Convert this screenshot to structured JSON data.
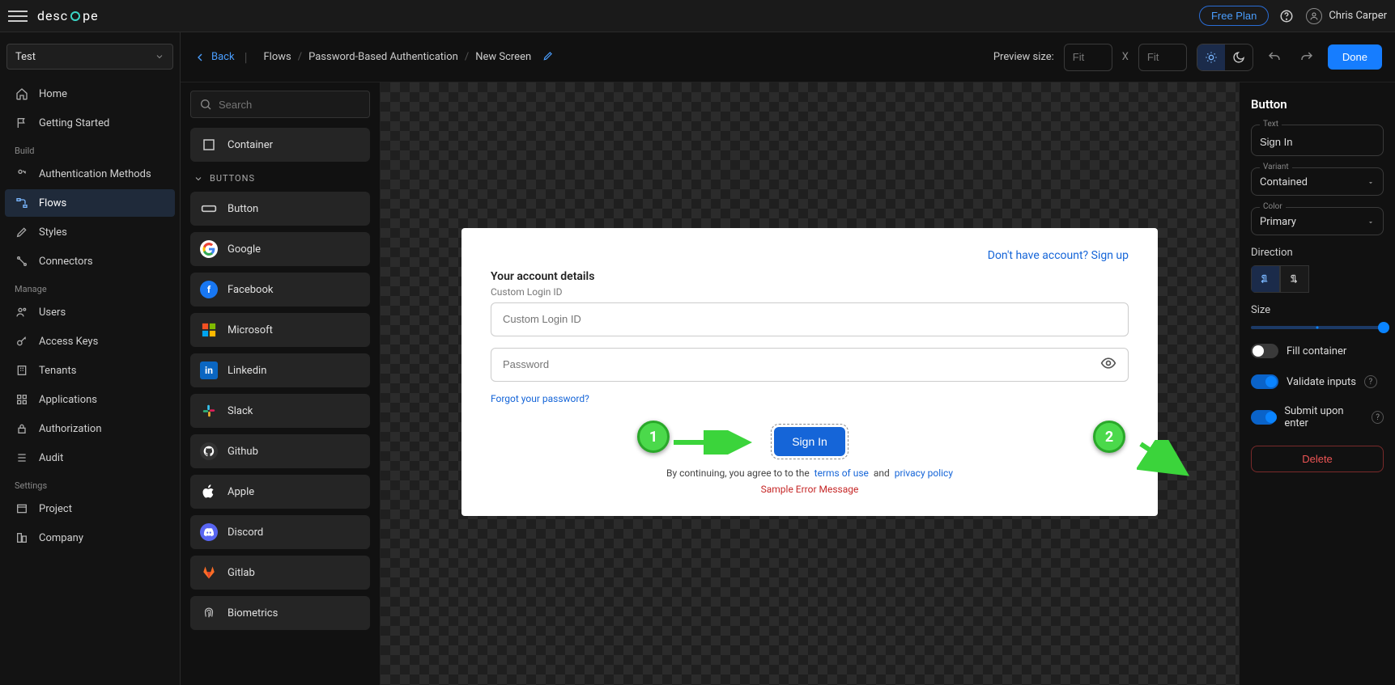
{
  "topbar": {
    "brand": "descope",
    "free_plan": "Free Plan",
    "user_name": "Chris Carper"
  },
  "sidebar": {
    "env": "Test",
    "groups": [
      {
        "items": [
          {
            "label": "Home",
            "icon": "home"
          },
          {
            "label": "Getting Started",
            "icon": "flag"
          }
        ]
      },
      {
        "label": "Build",
        "items": [
          {
            "label": "Authentication Methods",
            "icon": "auth"
          },
          {
            "label": "Flows",
            "icon": "flows",
            "active": true
          },
          {
            "label": "Styles",
            "icon": "styles"
          },
          {
            "label": "Connectors",
            "icon": "connectors"
          }
        ]
      },
      {
        "label": "Manage",
        "items": [
          {
            "label": "Users",
            "icon": "users"
          },
          {
            "label": "Access Keys",
            "icon": "keys"
          },
          {
            "label": "Tenants",
            "icon": "tenants"
          },
          {
            "label": "Applications",
            "icon": "apps"
          },
          {
            "label": "Authorization",
            "icon": "authz"
          },
          {
            "label": "Audit",
            "icon": "audit"
          }
        ]
      },
      {
        "label": "Settings",
        "items": [
          {
            "label": "Project",
            "icon": "project"
          },
          {
            "label": "Company",
            "icon": "company"
          }
        ]
      }
    ]
  },
  "toolbar": {
    "back": "Back",
    "crumbs": [
      "Flows",
      "Password-Based Authentication",
      "New Screen"
    ],
    "preview_label": "Preview size:",
    "fit_w": "Fit",
    "fit_h": "Fit",
    "done": "Done"
  },
  "palette": {
    "search_placeholder": "Search",
    "container": "Container",
    "buttons_label": "BUTTONS",
    "items": [
      {
        "label": "Button",
        "icon": "button"
      },
      {
        "label": "Google",
        "icon": "google"
      },
      {
        "label": "Facebook",
        "icon": "facebook"
      },
      {
        "label": "Microsoft",
        "icon": "microsoft"
      },
      {
        "label": "Linkedin",
        "icon": "linkedin"
      },
      {
        "label": "Slack",
        "icon": "slack"
      },
      {
        "label": "Github",
        "icon": "github"
      },
      {
        "label": "Apple",
        "icon": "apple"
      },
      {
        "label": "Discord",
        "icon": "discord"
      },
      {
        "label": "Gitlab",
        "icon": "gitlab"
      },
      {
        "label": "Biometrics",
        "icon": "biometrics"
      }
    ]
  },
  "canvas": {
    "signup": "Don't have account? Sign up",
    "heading": "Your account details",
    "subheading": "Custom Login ID",
    "login_placeholder": "Custom Login ID",
    "password_placeholder": "Password",
    "forgot": "Forgot your password?",
    "signin": "Sign In",
    "legal_pre": "By continuing, you agree to to the",
    "terms": "terms of use",
    "and": "and",
    "privacy": "privacy policy",
    "error": "Sample Error Message",
    "badge1": "1",
    "badge2": "2"
  },
  "props": {
    "title": "Button",
    "text_label": "Text",
    "text_value": "Sign In",
    "variant_label": "Variant",
    "variant_value": "Contained",
    "color_label": "Color",
    "color_value": "Primary",
    "direction_label": "Direction",
    "size_label": "Size",
    "fill_container": "Fill container",
    "validate_inputs": "Validate inputs",
    "submit_enter": "Submit upon enter",
    "delete": "Delete"
  }
}
